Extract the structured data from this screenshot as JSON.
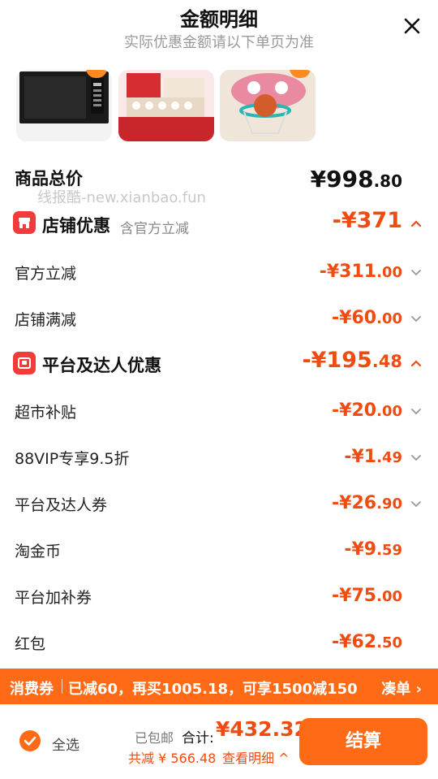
{
  "header": {
    "title": "金额明细",
    "subtitle": "实际优惠金额请以下单页为准"
  },
  "watermark": "线报酷-new.xianbao.fun",
  "total": {
    "label": "商品总价",
    "currency": "¥",
    "int": "998",
    "dec": ".80"
  },
  "store_section": {
    "title": "店铺优惠",
    "note": "含官方立减",
    "amount_int": "-¥371",
    "amount_dec": "",
    "items": [
      {
        "label": "官方立减",
        "amount_int": "-¥311",
        "amount_dec": ".00",
        "expandable": true
      },
      {
        "label": "店铺满减",
        "amount_int": "-¥60",
        "amount_dec": ".00",
        "expandable": true
      }
    ]
  },
  "platform_section": {
    "title": "平台及达人优惠",
    "amount_int": "-¥195",
    "amount_dec": ".48",
    "items": [
      {
        "label": "超市补贴",
        "amount_int": "-¥20",
        "amount_dec": ".00",
        "expandable": true
      },
      {
        "label": "88VIP专享9.5折",
        "amount_int": "-¥1",
        "amount_dec": ".49",
        "expandable": true
      },
      {
        "label": "平台及达人券",
        "amount_int": "-¥26",
        "amount_dec": ".90",
        "expandable": true
      },
      {
        "label": "淘金币",
        "amount_int": "-¥9",
        "amount_dec": ".59",
        "expandable": false
      },
      {
        "label": "平台加补券",
        "amount_int": "-¥75",
        "amount_dec": ".00",
        "expandable": false
      },
      {
        "label": "红包",
        "amount_int": "-¥62",
        "amount_dec": ".50",
        "expandable": false
      }
    ]
  },
  "banner": {
    "tag": "消费券",
    "text": "已减60，再买1005.18，可享1500减150",
    "link": "凑单"
  },
  "footer": {
    "select_all": "全选",
    "shipping": "已包邮",
    "sum_label": "合计:",
    "sum_value": "¥432.32",
    "saved": "共减 ¥ 566.48",
    "detail_link": "查看明细",
    "pay_button": "结算"
  },
  "colors": {
    "accent": "#ff6a16",
    "price": "#f04b10",
    "badge_red": "#f23b3b"
  },
  "icons": {
    "close": "close-icon",
    "chevron_down": "chevron-down-icon",
    "chevron_up": "chevron-up-icon",
    "store": "store-icon",
    "gift": "gift-icon",
    "check": "check-icon"
  }
}
